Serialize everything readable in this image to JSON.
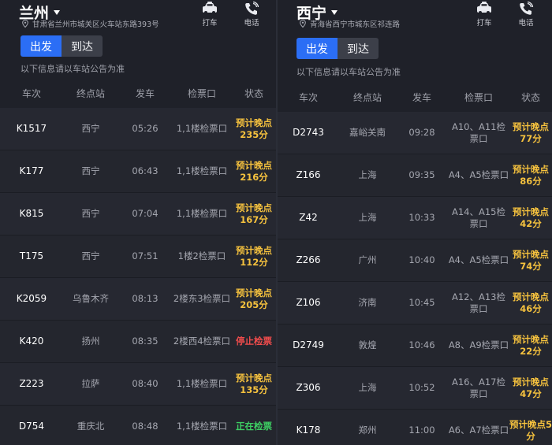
{
  "left": {
    "city": "兰州",
    "address": "甘肃省兰州市城关区火车站东路393号",
    "taxi_label": "打车",
    "phone_label": "电话",
    "tabs": {
      "depart": "出发",
      "arrive": "到达"
    },
    "notice": "以下信息请以车站公告为准",
    "columns": [
      "车次",
      "终点站",
      "发车",
      "检票口",
      "状态"
    ],
    "rows": [
      {
        "train": "K1517",
        "dest": "西宁",
        "time": "05:26",
        "gate": "1,1楼检票口",
        "status": "预计晚点235分",
        "status_type": "late"
      },
      {
        "train": "K177",
        "dest": "西宁",
        "time": "06:43",
        "gate": "1,1楼检票口",
        "status": "预计晚点216分",
        "status_type": "late"
      },
      {
        "train": "K815",
        "dest": "西宁",
        "time": "07:04",
        "gate": "1,1楼检票口",
        "status": "预计晚点167分",
        "status_type": "late"
      },
      {
        "train": "T175",
        "dest": "西宁",
        "time": "07:51",
        "gate": "1楼2检票口",
        "status": "预计晚点112分",
        "status_type": "late"
      },
      {
        "train": "K2059",
        "dest": "乌鲁木齐",
        "time": "08:13",
        "gate": "2楼东3检票口",
        "status": "预计晚点205分",
        "status_type": "late"
      },
      {
        "train": "K420",
        "dest": "扬州",
        "time": "08:35",
        "gate": "2楼西4检票口",
        "status": "停止检票",
        "status_type": "stop"
      },
      {
        "train": "Z223",
        "dest": "拉萨",
        "time": "08:40",
        "gate": "1,1楼检票口",
        "status": "预计晚点135分",
        "status_type": "late"
      },
      {
        "train": "D754",
        "dest": "重庆北",
        "time": "08:48",
        "gate": "1,1楼检票口",
        "status": "正在检票",
        "status_type": "open"
      }
    ]
  },
  "right": {
    "city": "西宁",
    "address": "青海省西宁市城东区祁连路",
    "taxi_label": "打车",
    "phone_label": "电话",
    "tabs": {
      "depart": "出发",
      "arrive": "到达"
    },
    "notice": "以下信息请以车站公告为准",
    "columns": [
      "车次",
      "终点站",
      "发车",
      "检票口",
      "状态"
    ],
    "rows": [
      {
        "train": "D2743",
        "dest": "嘉峪关南",
        "time": "09:28",
        "gate": "A10、A11检票口",
        "status": "预计晚点77分",
        "status_type": "late"
      },
      {
        "train": "Z166",
        "dest": "上海",
        "time": "09:35",
        "gate": "A4、A5检票口",
        "status": "预计晚点86分",
        "status_type": "late"
      },
      {
        "train": "Z42",
        "dest": "上海",
        "time": "10:33",
        "gate": "A14、A15检票口",
        "status": "预计晚点42分",
        "status_type": "late"
      },
      {
        "train": "Z266",
        "dest": "广州",
        "time": "10:40",
        "gate": "A4、A5检票口",
        "status": "预计晚点74分",
        "status_type": "late"
      },
      {
        "train": "Z106",
        "dest": "济南",
        "time": "10:45",
        "gate": "A12、A13检票口",
        "status": "预计晚点46分",
        "status_type": "late"
      },
      {
        "train": "D2749",
        "dest": "敦煌",
        "time": "10:46",
        "gate": "A8、A9检票口",
        "status": "预计晚点22分",
        "status_type": "late"
      },
      {
        "train": "Z306",
        "dest": "上海",
        "time": "10:52",
        "gate": "A16、A17检票口",
        "status": "预计晚点47分",
        "status_type": "late"
      },
      {
        "train": "K178",
        "dest": "郑州",
        "time": "11:00",
        "gate": "A6、A7检票口",
        "status": "预计晚点5分",
        "status_type": "late"
      }
    ]
  },
  "colors": {
    "accent": "#2b6ef5",
    "late": "#f6c23e",
    "stop": "#ef4c4c",
    "open": "#3dce63"
  },
  "icons": {
    "taxi": "taxi-icon",
    "phone": "phone-icon",
    "location": "location-pin-icon",
    "dropdown": "caret-down-icon"
  }
}
